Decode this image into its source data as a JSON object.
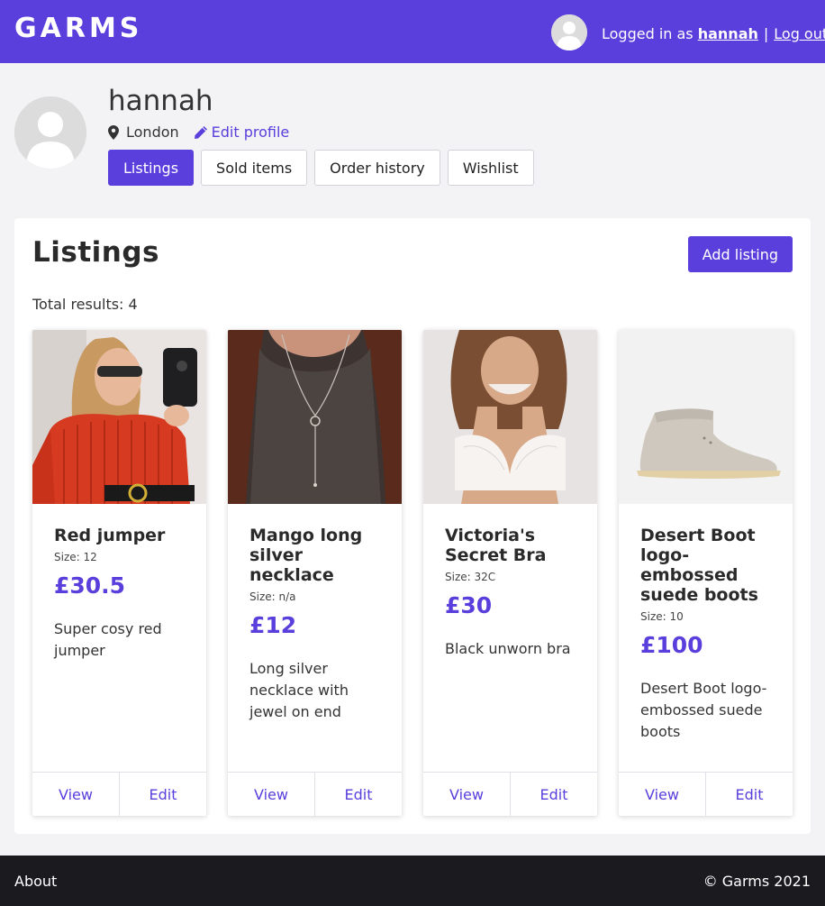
{
  "header": {
    "logo": "GARMS",
    "logged_in_prefix": "Logged in as ",
    "username": "hannah",
    "separator": "|",
    "logout_label": "Log out"
  },
  "profile": {
    "name": "hannah",
    "location": "London",
    "edit_label": "Edit profile",
    "tabs": [
      {
        "label": "Listings",
        "active": true
      },
      {
        "label": "Sold items",
        "active": false
      },
      {
        "label": "Order history",
        "active": false
      },
      {
        "label": "Wishlist",
        "active": false
      }
    ]
  },
  "listings": {
    "title": "Listings",
    "add_label": "Add listing",
    "total_label": "Total results: 4",
    "items": [
      {
        "title": "Red jumper",
        "size": "Size: 12",
        "price": "£30.5",
        "description": "Super cosy red jumper",
        "image": "red-jumper-photo"
      },
      {
        "title": "Mango long silver necklace",
        "size": "Size: n/a",
        "price": "£12",
        "description": "Long silver necklace with jewel on end",
        "image": "necklace-photo"
      },
      {
        "title": "Victoria's Secret Bra",
        "size": "Size: 32C",
        "price": "£30",
        "description": "Black unworn bra",
        "image": "bra-photo"
      },
      {
        "title": "Desert Boot logo-embossed suede boots",
        "size": "Size: 10",
        "price": "£100",
        "description": "Desert Boot logo-embossed suede boots",
        "image": "boot-photo"
      }
    ],
    "view_label": "View",
    "edit_label": "Edit"
  },
  "footer": {
    "about_label": "About",
    "copyright": "© Garms 2021"
  },
  "colors": {
    "brand": "#5a3fdc",
    "footer": "#1b1a1f",
    "background": "#f3f2f4"
  }
}
